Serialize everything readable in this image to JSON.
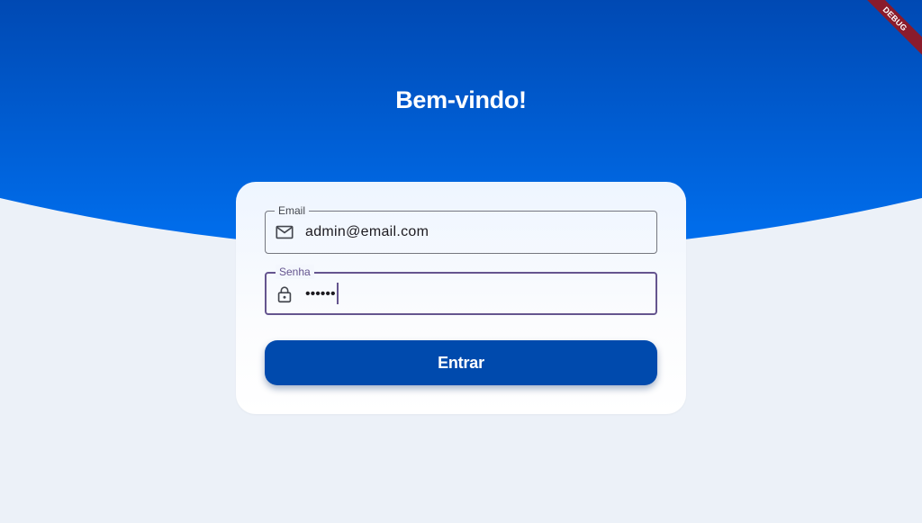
{
  "header": {
    "title": "Bem-vindo!",
    "debug_banner": "DEBUG"
  },
  "form": {
    "email": {
      "label": "Email",
      "value": "admin@email.com",
      "icon": "mail-icon"
    },
    "password": {
      "label": "Senha",
      "masked_value": "••••••",
      "icon": "lock-icon"
    },
    "submit_label": "Entrar"
  },
  "colors": {
    "header_top": "#004aad",
    "header_bottom": "#0070f0",
    "page_background": "#ecf1f8",
    "button": "#004aad",
    "focus": "#65558f"
  }
}
